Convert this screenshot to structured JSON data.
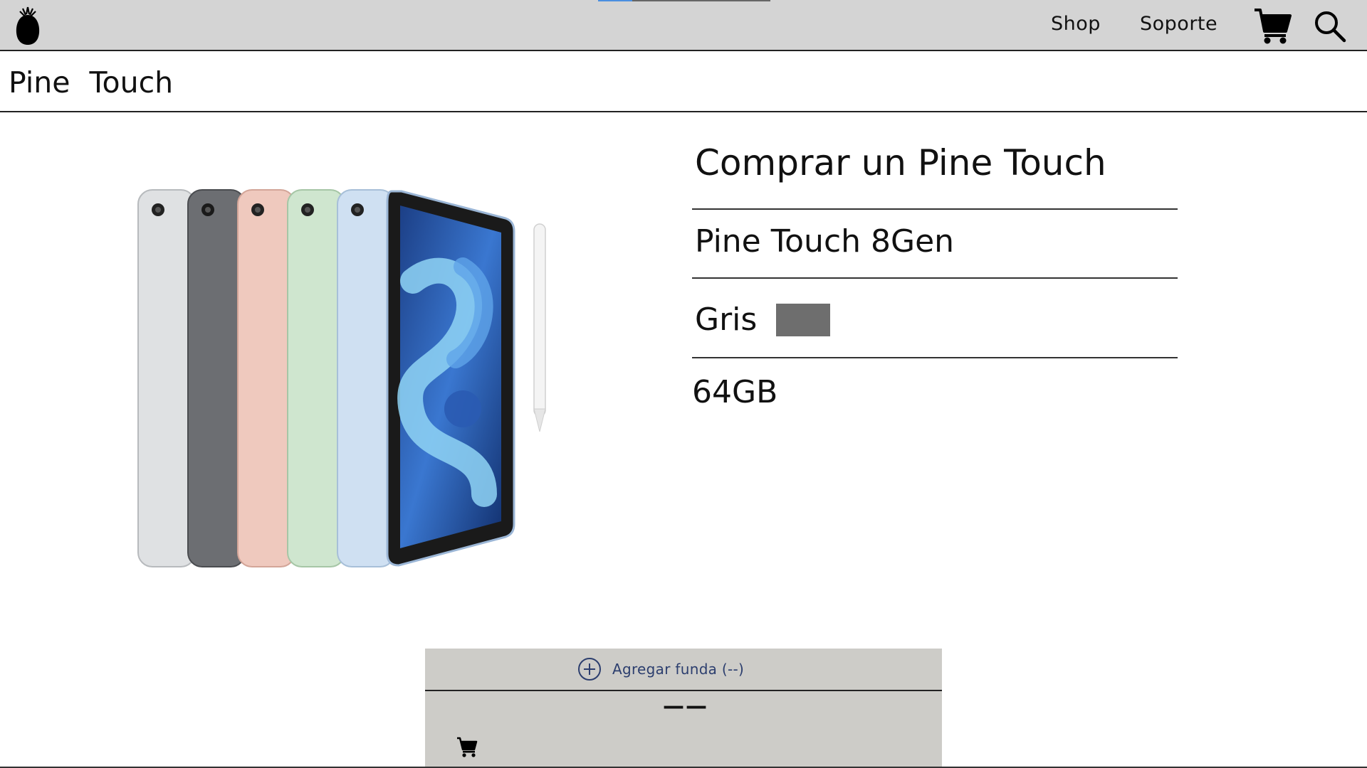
{
  "nav": {
    "links": [
      "Shop",
      "Soporte"
    ],
    "icons": [
      "pineapple-logo-icon",
      "cart-icon",
      "search-icon"
    ]
  },
  "subheader": {
    "title": "Pine  Touch"
  },
  "product": {
    "heading": "Comprar un Pine Touch",
    "model": "Pine Touch 8Gen",
    "color_label": "Gris",
    "color_value": "#6e6e6e",
    "storage": "64GB"
  },
  "bottom_panel": {
    "addon_label": "Agregar funda (--)",
    "price_placeholder": "——",
    "icons": [
      "plus-circle-icon",
      "cart-icon"
    ]
  },
  "colors": {
    "topbar_bg": "#d4d4d4",
    "panel_bg": "#cdccc8",
    "addon_text": "#2c3e6e",
    "scroll_accent": "#4a8fe0"
  }
}
